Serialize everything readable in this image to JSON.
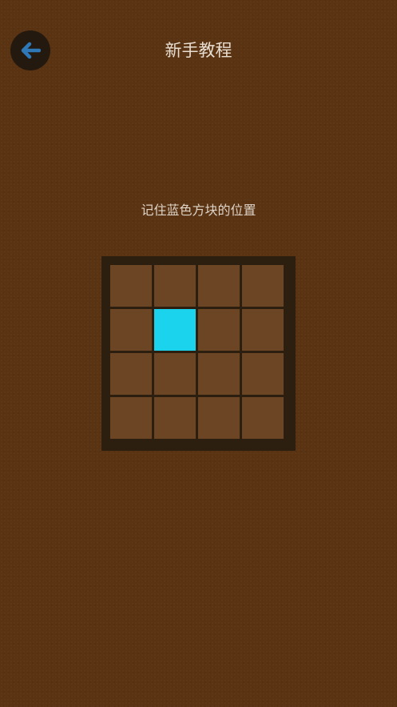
{
  "header": {
    "title": "新手教程",
    "back_icon": "arrow-left-icon"
  },
  "instruction": "记住蓝色方块的位置",
  "board": {
    "rows": 4,
    "cols": 4,
    "highlighted": [
      {
        "row": 1,
        "col": 1
      }
    ]
  },
  "colors": {
    "background": "#5a3312",
    "board_frame": "#2d1f0f",
    "cell": "#6c4624",
    "highlight": "#1bd3ec",
    "back_button_bg": "#24190e",
    "back_arrow": "#2f78b8"
  }
}
